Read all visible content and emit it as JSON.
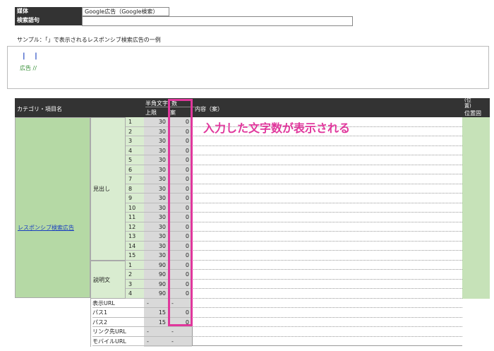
{
  "meta_table": {
    "media_label": "媒体",
    "media_value": "Google広告（Google検索）",
    "keyword_label": "検索語句",
    "keyword_value": ""
  },
  "sample": {
    "caption": "サンプル：「」で表示されるレスポンシブ検索広告の一例",
    "pipes": "|  |",
    "ad_label": "広告 //"
  },
  "table": {
    "headers": {
      "category": "カテゴリ・項目名",
      "halfwidth": "半角文字",
      "count": "数",
      "limit": "上限",
      "draft": "案",
      "content": "内容（案）",
      "position_fixed": "位置固",
      "col_top_fragment": "(位\n置)"
    },
    "category_name": "レスポンシブ検索広告",
    "groups": [
      {
        "name": "見出し",
        "rows": [
          {
            "n": "1",
            "limit": "30",
            "draft": "0"
          },
          {
            "n": "2",
            "limit": "30",
            "draft": "0"
          },
          {
            "n": "3",
            "limit": "30",
            "draft": "0"
          },
          {
            "n": "4",
            "limit": "30",
            "draft": "0"
          },
          {
            "n": "5",
            "limit": "30",
            "draft": "0"
          },
          {
            "n": "6",
            "limit": "30",
            "draft": "0"
          },
          {
            "n": "7",
            "limit": "30",
            "draft": "0"
          },
          {
            "n": "8",
            "limit": "30",
            "draft": "0"
          },
          {
            "n": "9",
            "limit": "30",
            "draft": "0"
          },
          {
            "n": "10",
            "limit": "30",
            "draft": "0"
          },
          {
            "n": "11",
            "limit": "30",
            "draft": "0"
          },
          {
            "n": "12",
            "limit": "30",
            "draft": "0"
          },
          {
            "n": "13",
            "limit": "30",
            "draft": "0"
          },
          {
            "n": "14",
            "limit": "30",
            "draft": "0"
          },
          {
            "n": "15",
            "limit": "30",
            "draft": "0"
          }
        ]
      },
      {
        "name": "説明文",
        "rows": [
          {
            "n": "1",
            "limit": "90",
            "draft": "0"
          },
          {
            "n": "2",
            "limit": "90",
            "draft": "0"
          },
          {
            "n": "3",
            "limit": "90",
            "draft": "0"
          },
          {
            "n": "4",
            "limit": "90",
            "draft": "0"
          }
        ]
      }
    ],
    "extra_rows": [
      {
        "label": "表示URL",
        "limit": "-",
        "draft": "-"
      },
      {
        "label": "パス1",
        "limit": "15",
        "draft": "0"
      },
      {
        "label": "パス2",
        "limit": "15",
        "draft": "0"
      },
      {
        "label": "リンク先URL",
        "limit": "-",
        "draft": "-"
      },
      {
        "label": "モバイルURL",
        "limit": "-",
        "draft": "-"
      }
    ]
  },
  "callout": {
    "text": "入力した文字数が表示される",
    "color": "#e0379c"
  },
  "colors": {
    "header_bg": "#333333",
    "green_dark": "#b5d9a5",
    "green_light": "#d9ecd0",
    "gray": "#d9d9d9",
    "highlight": "#e0379c"
  }
}
